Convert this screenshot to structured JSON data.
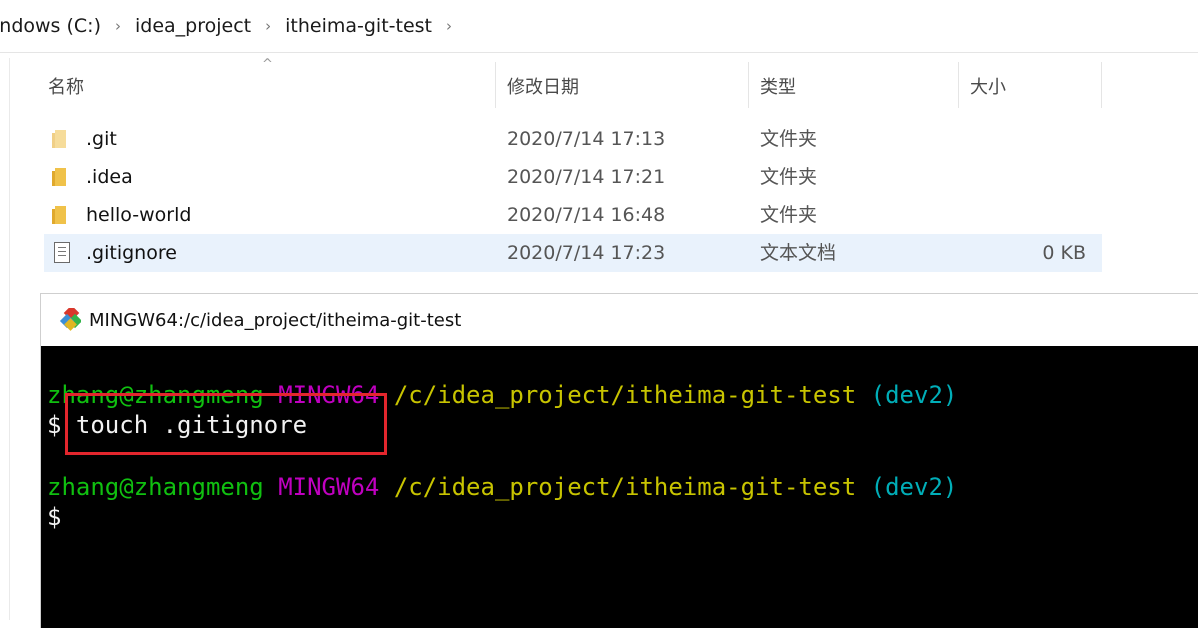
{
  "explorer": {
    "breadcrumb": [
      "indows (C:)",
      "idea_project",
      "itheima-git-test"
    ],
    "breadcrumb_separator": "›",
    "columns": {
      "name": "名称",
      "modified": "修改日期",
      "type": "类型",
      "size": "大小"
    },
    "sort_indicator": "^",
    "files": [
      {
        "name": ".git",
        "modified": "2020/7/14 17:13",
        "type": "文件夹",
        "size": "",
        "icon": "folder-icon-hidden"
      },
      {
        "name": ".idea",
        "modified": "2020/7/14 17:21",
        "type": "文件夹",
        "size": "",
        "icon": "folder-icon"
      },
      {
        "name": "hello-world",
        "modified": "2020/7/14 16:48",
        "type": "文件夹",
        "size": "",
        "icon": "folder-icon"
      },
      {
        "name": ".gitignore",
        "modified": "2020/7/14 17:23",
        "type": "文本文档",
        "size": "0 KB",
        "icon": "text-file-icon",
        "selected": true
      }
    ]
  },
  "terminal": {
    "title": "MINGW64:/c/idea_project/itheima-git-test",
    "prompt": {
      "user_host": "zhang@zhangmeng",
      "system": "MINGW64",
      "path": "/c/idea_project/itheima-git-test",
      "branch": "(dev2)"
    },
    "dollar": "$",
    "command": "touch .gitignore",
    "colors": {
      "user": "#10c010",
      "system": "#c000c0",
      "path": "#c8c400",
      "branch": "#00aeb8",
      "highlight": "#e3262d"
    }
  }
}
